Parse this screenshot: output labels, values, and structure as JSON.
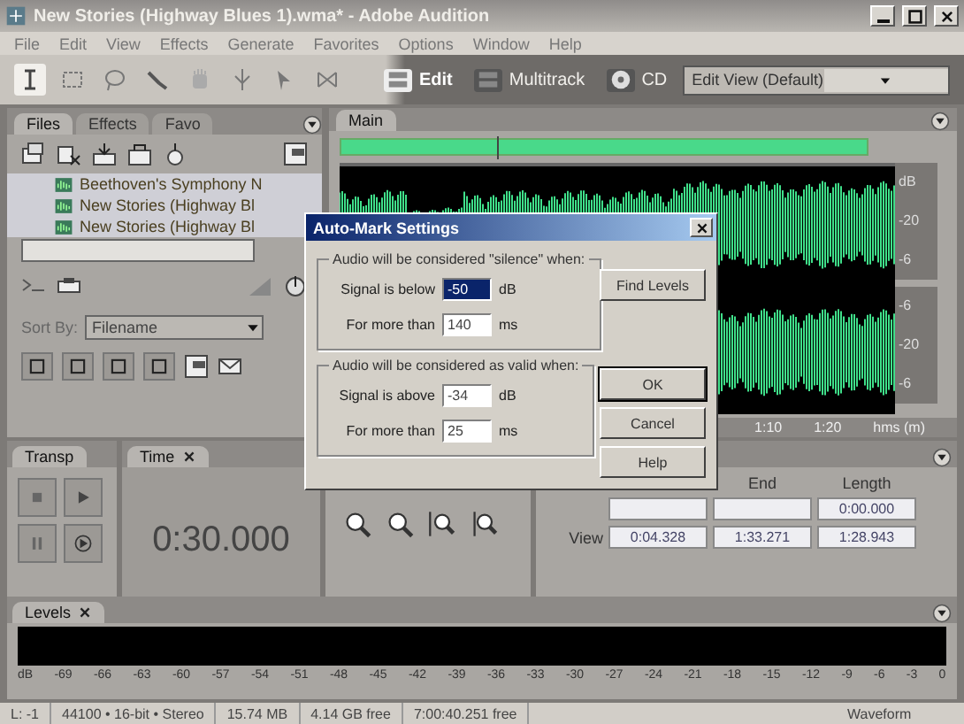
{
  "window": {
    "title": "New Stories (Highway Blues 1).wma* - Adobe Audition"
  },
  "menu": [
    "File",
    "Edit",
    "View",
    "Effects",
    "Generate",
    "Favorites",
    "Options",
    "Window",
    "Help"
  ],
  "modes": [
    {
      "label": "Edit",
      "selected": true
    },
    {
      "label": "Multitrack",
      "selected": false
    },
    {
      "label": "CD",
      "selected": false
    }
  ],
  "workspace": {
    "value": "Edit View (Default)"
  },
  "files_panel": {
    "tabs": [
      {
        "label": "Files",
        "selected": true
      },
      {
        "label": "Effects",
        "selected": false
      },
      {
        "label": "Favo",
        "selected": false
      }
    ],
    "files": [
      "Beethoven's Symphony N",
      "New Stories (Highway Bl",
      "New Stories (Highway Bl"
    ],
    "sort_by": {
      "label": "Sort By:",
      "value": "Filename"
    }
  },
  "main_panel": {
    "tab": "Main",
    "db_upper": [
      "dB",
      "-20",
      "-6"
    ],
    "db_lower": [
      "-6",
      "-20",
      "-6"
    ],
    "time_labels": [
      "1:10",
      "1:20",
      "hms (m)"
    ]
  },
  "transport": {
    "tab": "Transp"
  },
  "time": {
    "tab": "Time",
    "value": "0:30.000"
  },
  "selection": {
    "end_header": "End",
    "length_header": "Length",
    "selection_length": "0:00.000",
    "view": {
      "label": "View",
      "begin": "0:04.328",
      "end": "1:33.271",
      "length": "1:28.943"
    }
  },
  "levels": {
    "tab": "Levels",
    "scale": [
      "dB",
      "-69",
      "-66",
      "-63",
      "-60",
      "-57",
      "-54",
      "-51",
      "-48",
      "-45",
      "-42",
      "-39",
      "-36",
      "-33",
      "-30",
      "-27",
      "-24",
      "-21",
      "-18",
      "-15",
      "-12",
      "-9",
      "-6",
      "-3",
      "0"
    ]
  },
  "status_bar": [
    "L: -1",
    "44100 • 16-bit • Stereo",
    "15.74 MB",
    "4.14 GB free",
    "7:00:40.251 free",
    "Waveform"
  ],
  "dialog": {
    "title": "Auto-Mark Settings",
    "groups": [
      {
        "legend": "Audio will be considered \"silence\" when:",
        "rows": [
          {
            "label": "Signal is below",
            "value": "-50",
            "unit": "dB",
            "selected": true
          },
          {
            "label": "For more than",
            "value": "140",
            "unit": "ms",
            "selected": false
          }
        ]
      },
      {
        "legend": "Audio will be considered as valid when:",
        "rows": [
          {
            "label": "Signal is above",
            "value": "-34",
            "unit": "dB",
            "selected": false
          },
          {
            "label": "For more than",
            "value": "25",
            "unit": "ms",
            "selected": false
          }
        ]
      }
    ],
    "find_button": "Find Levels",
    "buttons": [
      "OK",
      "Cancel",
      "Help"
    ]
  }
}
